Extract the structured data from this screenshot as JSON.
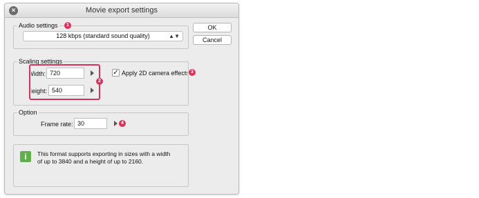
{
  "window": {
    "title": "Movie export settings"
  },
  "audio": {
    "group_label": "Audio settings",
    "quality_value": "128 kbps (standard sound quality)"
  },
  "buttons": {
    "ok": "OK",
    "cancel": "Cancel"
  },
  "scaling": {
    "group_label": "Scaling settings",
    "width_label": "Width:",
    "width_value": "720",
    "height_label": "Height:",
    "height_value": "540",
    "camera_effects_label": "Apply 2D camera effects",
    "camera_effects_checked": true
  },
  "option": {
    "group_label": "Option",
    "frame_rate_label": "Frame rate:",
    "frame_rate_value": "30"
  },
  "info": {
    "text_line1": "This format supports exporting in sizes with a width",
    "text_line2": "of up to 3840 and a height of up to 2160."
  },
  "markers": {
    "m1": "1",
    "m2": "2",
    "m3": "3",
    "m4": "4"
  },
  "colors": {
    "marker": "#d8315b",
    "info_icon": "#5fb04a"
  },
  "icons": {
    "close": "close-icon",
    "info": "info-icon",
    "check": "checkmark-icon"
  }
}
